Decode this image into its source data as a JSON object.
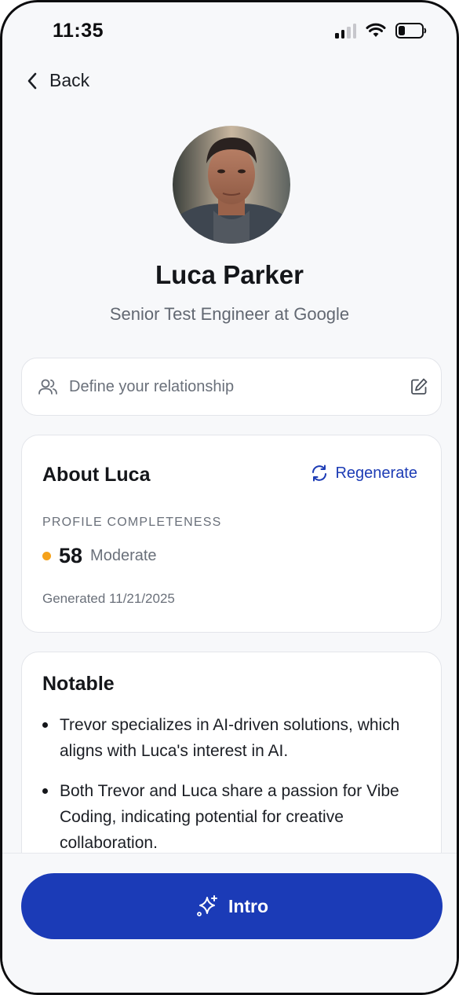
{
  "status_bar": {
    "time": "11:35",
    "signal_icon": "cellular-signal-icon",
    "wifi_icon": "wifi-icon",
    "battery_icon": "battery-low-icon"
  },
  "nav": {
    "back_label": "Back",
    "back_icon": "chevron-left-icon"
  },
  "profile": {
    "name": "Luca Parker",
    "title": "Senior Test Engineer at Google"
  },
  "relationship": {
    "placeholder": "Define your relationship",
    "people_icon": "people-icon",
    "edit_icon": "edit-icon"
  },
  "about": {
    "heading": "About Luca",
    "regenerate_label": "Regenerate",
    "regenerate_icon": "refresh-icon",
    "completeness_label": "PROFILE COMPLETENESS",
    "score": "58",
    "score_level": "Moderate",
    "score_color": "#f5a21b",
    "generated": "Generated 11/21/2025"
  },
  "notable": {
    "heading": "Notable",
    "items": [
      "Trevor specializes in AI-driven solutions, which aligns with Luca's interest in AI.",
      "Both Trevor and Luca share a passion for Vibe Coding, indicating potential for creative collaboration."
    ]
  },
  "action": {
    "intro_label": "Intro",
    "intro_icon": "sparkles-icon"
  },
  "colors": {
    "accent": "#1b3bb7",
    "background": "#f7f8fa",
    "card": "#ffffff"
  }
}
